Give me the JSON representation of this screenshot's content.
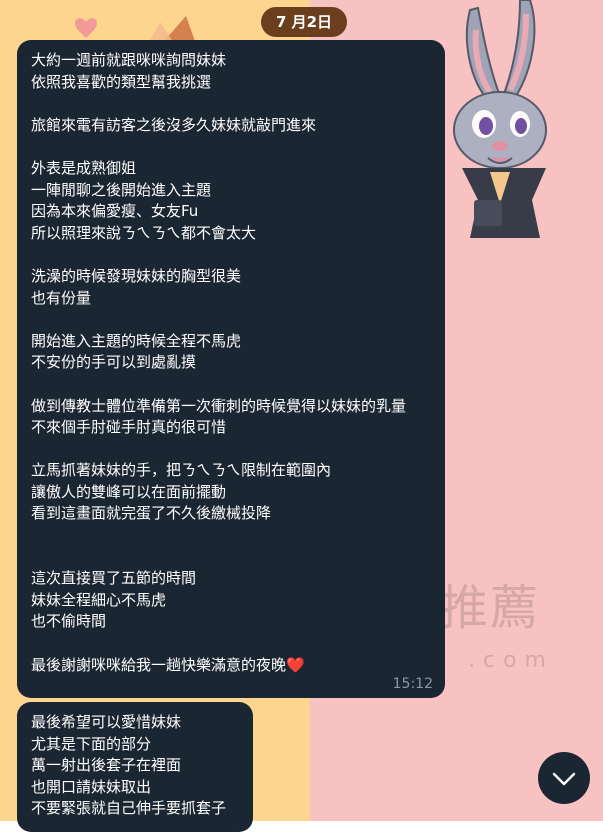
{
  "chat": {
    "date_chip": "7 月2日",
    "messages": [
      {
        "lines": [
          "大約一週前就跟咪咪詢問妹妹",
          "依照我喜歡的類型幫我挑選",
          "",
          "旅館來電有訪客之後沒多久妹妹就敲門進來",
          "",
          "外表是成熟御姐",
          "一陣閒聊之後開始進入主題",
          "因為本來偏愛瘦、女友Fu",
          "所以照理來說ㄋㄟㄋㄟ都不會太大",
          "",
          "洗澡的時候發現妹妹的胸型很美",
          "也有份量",
          "",
          "開始進入主題的時候全程不馬虎",
          "不安份的手可以到處亂摸",
          "",
          "做到傳教士體位準備第一次衝刺的時候覺得以妹妹的乳量",
          "不來個手肘碰手肘真的很可惜",
          "",
          "立馬抓著妹妹的手，把ㄋㄟㄋㄟ限制在範圍內",
          "讓傲人的雙峰可以在面前擺動",
          "看到這畫面就完蛋了不久後繳械投降",
          "",
          "",
          "這次直接買了五節的時間",
          "妹妹全程細心不馬虎",
          "也不偷時間",
          "",
          "最後謝謝咪咪給我一趟快樂滿意的夜晚"
        ],
        "emoji": "❤️",
        "time": "15:12"
      },
      {
        "lines": [
          "最後希望可以愛惜妹妹",
          "尤其是下面的部分",
          "萬一射出後套子在裡面",
          "也開口請妹妹取出",
          "不要緊張就自己伸手要抓套子"
        ]
      }
    ]
  },
  "wallpaper": {
    "watermark": "推薦",
    "watermark_sub": ".com"
  },
  "icons": {
    "scroll_down": "chevron-down-icon"
  },
  "colors": {
    "bubble": "#1b2633",
    "date_chip": "#6b3f1d",
    "bg_left": "#fdd58f",
    "bg_right": "#f8c2c2"
  }
}
